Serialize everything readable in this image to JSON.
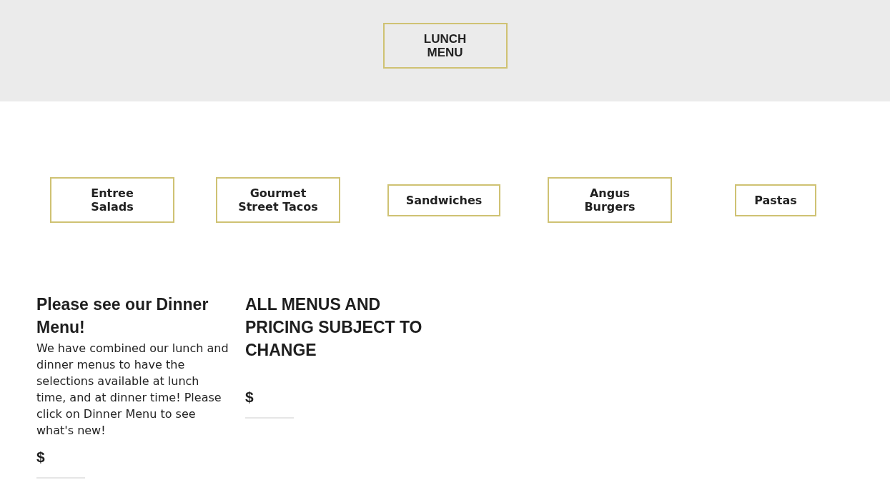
{
  "header": {
    "menu_button": {
      "label": "LUNCH\nMENU"
    }
  },
  "categories": [
    {
      "label": "Entree\nSalads"
    },
    {
      "label": "Gourmet\nStreet Tacos"
    },
    {
      "label": "Sandwiches"
    },
    {
      "label": "Angus\nBurgers"
    },
    {
      "label": "Pastas"
    }
  ],
  "items": [
    {
      "title": "Please see our Dinner Menu!",
      "description": "We have combined our lunch and dinner menus to have the selections available at lunch time, and at dinner time! Please click on Dinner Menu to see what's new!",
      "price": "$"
    },
    {
      "title": "ALL MENUS AND PRICING SUBJECT TO CHANGE",
      "price": "$"
    }
  ]
}
